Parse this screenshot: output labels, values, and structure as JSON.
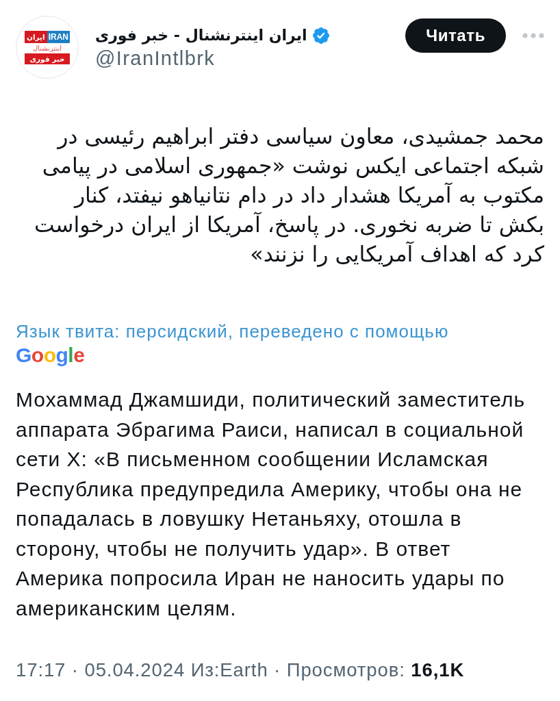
{
  "author": {
    "avatar_logo": {
      "top_left": "ایران",
      "top_right": "IRAN",
      "middle": "اینترنشنال",
      "bottom": "خبر فوری"
    },
    "name": "ایران اینترنشنال - خبر فوری",
    "verified": true,
    "handle": "@IranIntlbrk"
  },
  "follow_button": "Читать",
  "tweet_text": "محمد جمشیدی، معاون سیاسی دفتر ابراهیم رئیسی در شبکه اجتماعی ایکس نوشت «جمهوری اسلامی در پیامی مکتوب به آمریکا هشدار داد در دام نتانیاهو نیفتد، کنار بکش تا ضربه نخوری. در پاسخ، آمریکا از ایران درخواست کرد که اهداف آمریکایی را نزنند»",
  "translation": {
    "label": "Язык твита: персидский, переведено с помощью",
    "provider_logo": "Google",
    "text": "Мохаммад Джамшиди, политический заместитель аппарата Эбрагима Раиси, написал в социальной сети X: «В письменном сообщении Исламская Республика предупредила Америку, чтобы она не попадалась в ловушку Нетаньяху, отошла в сторону, чтобы не получить удар». В ответ Америка попросила Иран не наносить удары по американским целям."
  },
  "meta": "17:17 · 05.04.2024 Из:Earth · Просмотров: **16,1K**"
}
